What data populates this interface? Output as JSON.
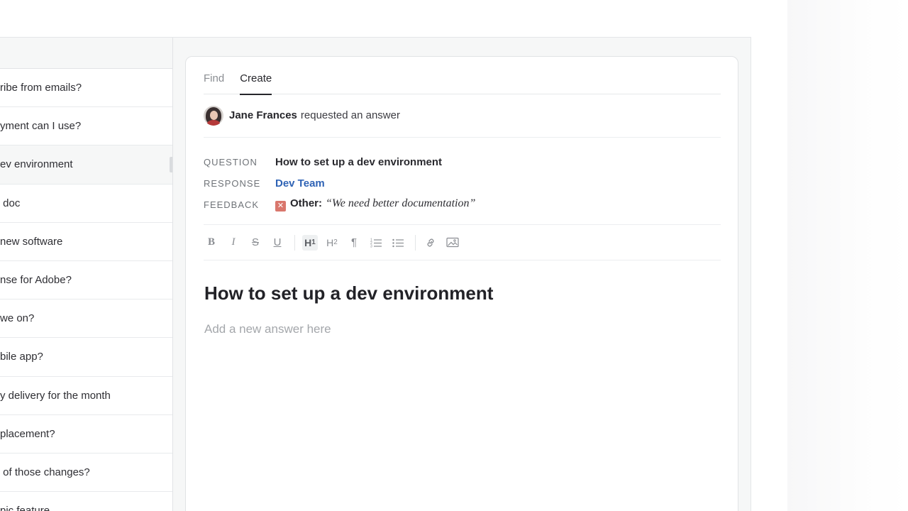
{
  "question_list": {
    "items": [
      {
        "text": "ribe from emails?"
      },
      {
        "text": "yment can I use?"
      },
      {
        "text": "ev environment",
        "selected": true
      },
      {
        "text": " doc"
      },
      {
        "text": "new software"
      },
      {
        "text": "nse for Adobe?"
      },
      {
        "text": "we on?"
      },
      {
        "text": "bile app?"
      },
      {
        "text": "y delivery for the month"
      },
      {
        "text": "placement?"
      },
      {
        "text": " of those changes?"
      },
      {
        "text": "pic feature"
      }
    ]
  },
  "tabs": [
    {
      "label": "Find",
      "active": false
    },
    {
      "label": "Create",
      "active": true
    }
  ],
  "request": {
    "requester_name": "Jane Frances",
    "action_text": "requested an answer"
  },
  "meta": {
    "question_label": "QUESTION",
    "question_value": "How to set up a dev environment",
    "response_label": "RESPONSE",
    "response_value": "Dev Team",
    "feedback_label": "FEEDBACK",
    "feedback_type": "Other:",
    "feedback_text": "“We need better documentation”"
  },
  "toolbar": {
    "buttons": [
      {
        "name": "bold-button",
        "glyph": "B",
        "active": false
      },
      {
        "name": "italic-button",
        "glyph": "I",
        "active": false
      },
      {
        "name": "strikethrough-button",
        "glyph": "S",
        "active": false
      },
      {
        "name": "underline-button",
        "glyph": "U",
        "active": false
      },
      {
        "name": "heading1-button",
        "glyph": "H1",
        "active": true
      },
      {
        "name": "heading2-button",
        "glyph": "H2",
        "active": false
      },
      {
        "name": "paragraph-button",
        "glyph": "¶",
        "active": false
      },
      {
        "name": "ordered-list-button",
        "glyph": "ol",
        "active": false
      },
      {
        "name": "bullet-list-button",
        "glyph": "ul",
        "active": false
      },
      {
        "name": "link-button",
        "glyph": "link",
        "active": false
      },
      {
        "name": "image-button",
        "glyph": "img",
        "active": false
      }
    ]
  },
  "editor": {
    "title": "How to set up a dev environment",
    "placeholder": "Add a new answer here"
  },
  "colors": {
    "accent_link": "#2f63b5",
    "feedback_badge": "#d9776d",
    "text_primary": "#26262b"
  }
}
